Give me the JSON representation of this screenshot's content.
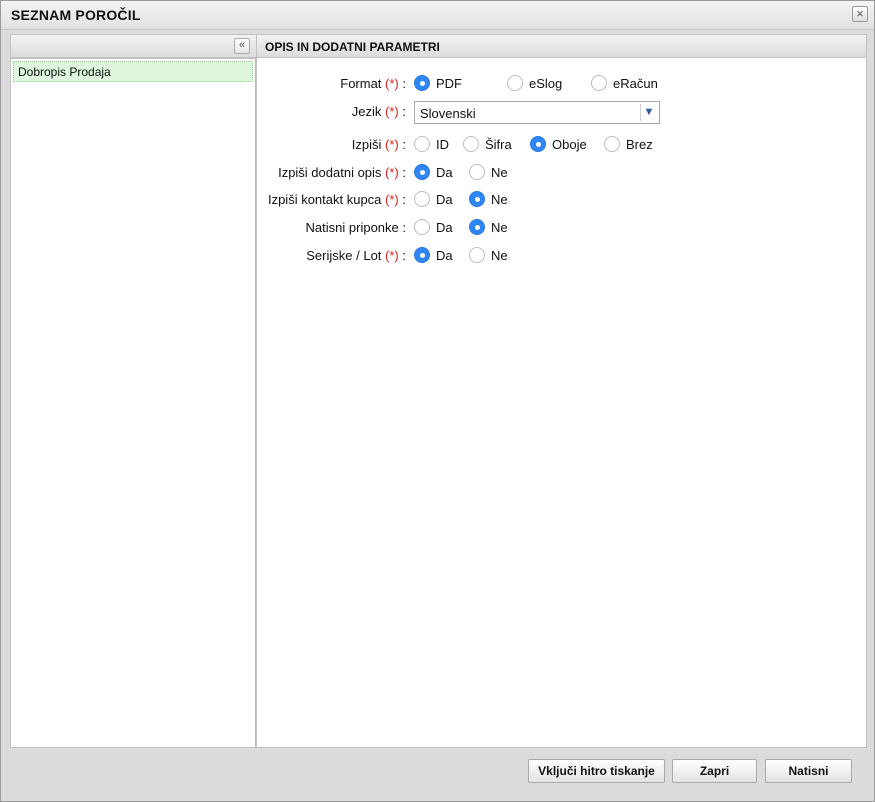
{
  "dialog": {
    "title": "SEZNAM POROČIL",
    "close_symbol": "×",
    "icons": {
      "close": "close-icon",
      "collapse": "double-chevron-left-icon",
      "dropdown": "chevron-down-icon"
    }
  },
  "left_panel": {
    "collapse_symbol": "«",
    "items": [
      {
        "label": "Dobropis Prodaja",
        "selected": true
      }
    ]
  },
  "right_panel": {
    "header": "OPIS IN DODATNI PARAMETRI",
    "required_mark": "(*)",
    "fields": {
      "format": {
        "label": "Format",
        "options": [
          "PDF",
          "eSlog",
          "eRačun"
        ],
        "selected": "PDF"
      },
      "jezik": {
        "label": "Jezik",
        "value": "Slovenski",
        "arrow": "⌄"
      },
      "izpisi": {
        "label": "Izpiši",
        "options": [
          "ID",
          "Šifra",
          "Oboje",
          "Brez"
        ],
        "selected": "Oboje"
      },
      "dodatni_opis": {
        "label": "Izpiši dodatni opis",
        "options": [
          "Da",
          "Ne"
        ],
        "selected": "Da"
      },
      "kontakt_kupca": {
        "label": "Izpiši kontakt kupca",
        "options": [
          "Da",
          "Ne"
        ],
        "selected": "Ne"
      },
      "priponke": {
        "label": "Natisni priponke :",
        "options": [
          "Da",
          "Ne"
        ],
        "selected": "Ne"
      },
      "serijske": {
        "label": "Serijske / Lot",
        "options": [
          "Da",
          "Ne"
        ],
        "selected": "Da"
      }
    }
  },
  "footer": {
    "quick_print": "Vključi hitro tiskanje",
    "close": "Zapri",
    "print": "Natisni"
  },
  "colors": {
    "radio_selected": "#2f86f6",
    "required": "#e02020",
    "selected_item_bg": "#dff5de"
  }
}
